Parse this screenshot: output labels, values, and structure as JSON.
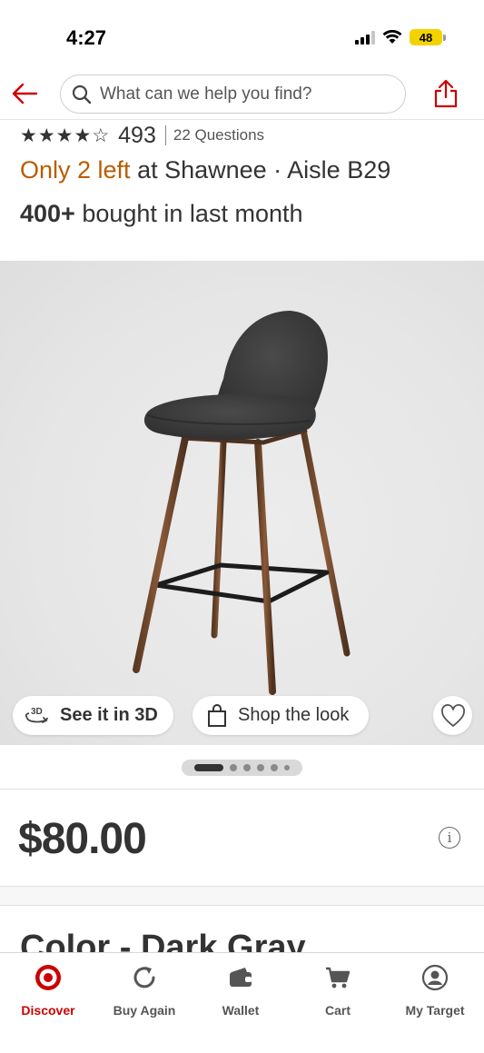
{
  "status_bar": {
    "time": "4:27",
    "battery": "48",
    "battery_color": "#f2d200"
  },
  "header": {
    "back_icon": "arrow-left-icon",
    "search_placeholder": "What can we help you find?",
    "share_icon": "share-icon",
    "accent_color": "#cc0000"
  },
  "product": {
    "rating_stars": 4,
    "rating_max": 5,
    "rating_count": "493",
    "questions": "22 Questions",
    "stock_highlight": "Only 2 left",
    "stock_rest": " at Shawnee · Aisle B29",
    "stock_color": "#b85c00",
    "bought_bold": "400+",
    "bought_rest": " bought in last month",
    "image_description_icon": "bar-stool-image",
    "see_3d_label": "See it in 3D",
    "shop_look_label": "Shop the look",
    "price": "$80.00",
    "color_heading": "Color - Dark Gray"
  },
  "carousel": {
    "total": 6,
    "active_index": 0
  },
  "bottom_nav": [
    {
      "label": "Discover",
      "icon": "target-logo-icon",
      "active": true
    },
    {
      "label": "Buy Again",
      "icon": "refresh-icon",
      "active": false
    },
    {
      "label": "Wallet",
      "icon": "wallet-icon",
      "active": false
    },
    {
      "label": "Cart",
      "icon": "cart-icon",
      "active": false
    },
    {
      "label": "My Target",
      "icon": "account-icon",
      "active": false
    }
  ]
}
